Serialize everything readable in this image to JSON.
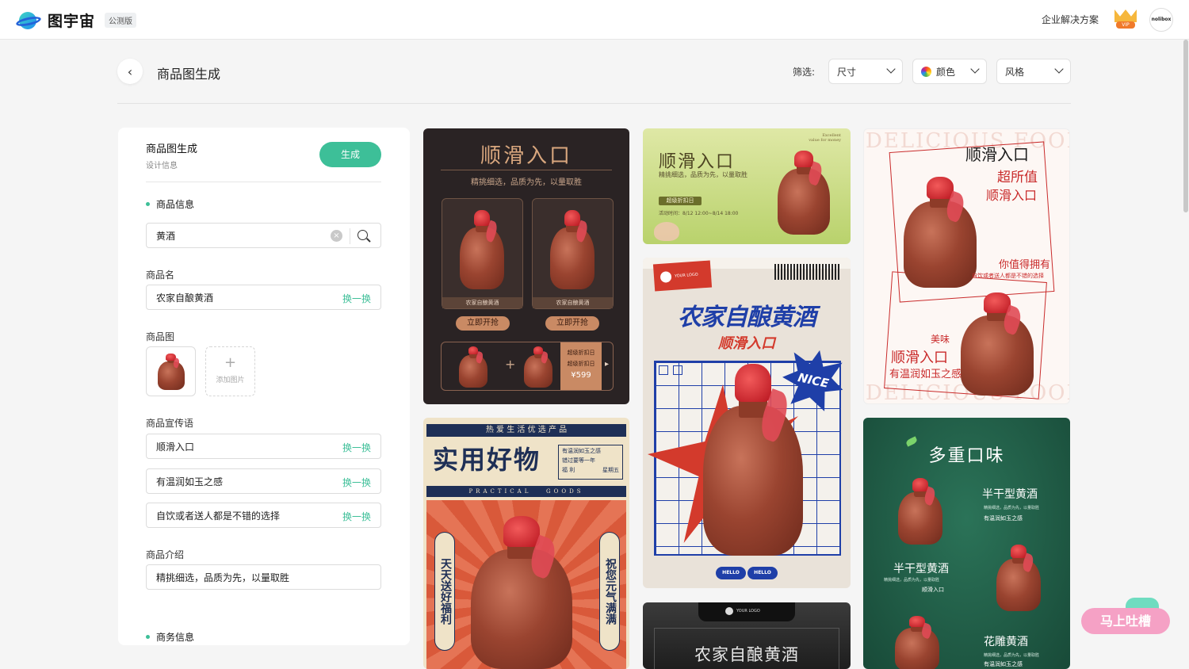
{
  "app": {
    "name": "图宇宙",
    "badge": "公测版",
    "enterprise_link": "企业解决方案",
    "vip_label": "VIP",
    "avatar_text": "nolibox"
  },
  "page": {
    "title": "商品图生成",
    "filter_label": "筛选:",
    "filters": [
      {
        "label": "尺寸"
      },
      {
        "label": "颜色"
      },
      {
        "label": "风格"
      }
    ]
  },
  "panel": {
    "title": "商品图生成",
    "subtitle": "设计信息",
    "generate_label": "生成",
    "section_product": "商品信息",
    "search_value": "黄酒",
    "name_label": "商品名",
    "name_value": "农家自酿黄酒",
    "swap_label": "换一换",
    "image_label": "商品图",
    "add_image_label": "添加图片",
    "slogan_label": "商品宣传语",
    "slogans": [
      "顺滑入口",
      "有温润如玉之感",
      "自饮或者送人都是不错的选择"
    ],
    "intro_label": "商品介绍",
    "intro_value": "精挑细选，品质为先，以量取胜",
    "section_business": "商务信息"
  },
  "cards": {
    "c1": {
      "title": "顺滑入口",
      "subtitle": "精挑细选，品质为先，以量取胜",
      "product_name": "农家自酿黄酒",
      "buy_label": "立即开抢",
      "promo_label": "超级折扣日",
      "price": "¥599"
    },
    "c2": {
      "title": "顺滑入口",
      "subtitle": "精挑细选，品质为先，以量取胜",
      "tag": "超级折扣日",
      "date": "活动时间：8/12 12:00~8/14 18:00",
      "corner_top": "Excellent",
      "corner_bottom": "value for money"
    },
    "c3": {
      "bg_text": "DELICIOUS FOOD",
      "title": "顺滑入口",
      "line2": "超所值",
      "line3": "顺滑入口",
      "line4": "你值得拥有",
      "line5": "自饮或者送人都是不错的选择",
      "bottom1": "美味",
      "bottom2": "顺滑入口",
      "bottom3": "有温润如玉之感"
    },
    "c4": {
      "logo": "YOUR LOGO",
      "title": "农家自酿黄酒",
      "subtitle": "顺滑入口",
      "burst": "NICE",
      "hello": "HELLO"
    },
    "c5": {
      "top_strip": "热 爱 生 活 优 选 产 品",
      "title": "实用好物",
      "note_line1": "有温润如玉之感",
      "note_line2": "错过要等一年",
      "note_left": "福 利",
      "note_right": "星期五",
      "en": "PRACTICAL   GOODS",
      "left_vertical": "天天送好福利",
      "right_vertical": "祝您元气满满"
    },
    "c6": {
      "logo": "YOUR LOGO",
      "title": "农家自酿黄酒"
    },
    "c7": {
      "title": "多重口味",
      "item1": "半干型黄酒",
      "item1_desc": "精挑细选，品质为先，以量取胜",
      "item1_sub": "有温润如玉之感",
      "item2": "半干型黄酒",
      "item2_desc": "精挑细选，品质为先，以量取胜",
      "item2_sub": "顺滑入口",
      "item3": "花雕黄酒",
      "item3_desc": "精挑细选，品质为先，以量取胜",
      "item3_sub": "有温润如玉之感"
    }
  },
  "feedback": {
    "label": "马上吐槽"
  },
  "colors": {
    "accent": "#3dbf98",
    "dark_card": "#2a2324",
    "green_card": "#1d5a44",
    "blue": "#1f3fa8",
    "red": "#d33a2c"
  }
}
